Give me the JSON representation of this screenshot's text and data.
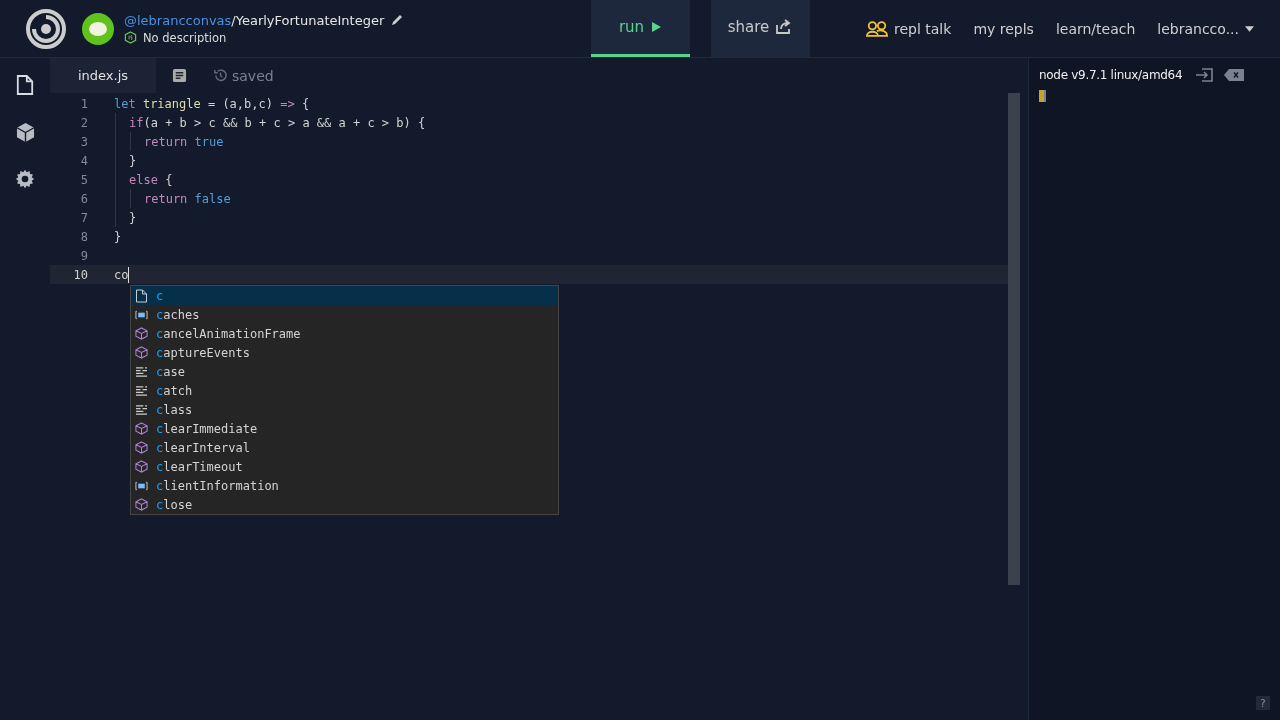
{
  "header": {
    "owner": "@lebrancconvas",
    "repl_name": "/YearlyFortunateInteger",
    "description": "No description",
    "actions": [
      {
        "label": "run",
        "kind": "run",
        "selected": true
      },
      {
        "label": "share",
        "kind": "share",
        "selected": false
      }
    ],
    "nav": [
      {
        "label": "repl talk",
        "kind": "talk"
      },
      {
        "label": "my repls",
        "kind": "plain"
      },
      {
        "label": "learn/teach",
        "kind": "plain"
      },
      {
        "label": "lebrancco...",
        "kind": "user"
      }
    ]
  },
  "sidebar": [
    {
      "kind": "files",
      "selected": true
    },
    {
      "kind": "packages",
      "selected": false
    },
    {
      "kind": "settings",
      "selected": false
    }
  ],
  "editor": {
    "tab": "index.js",
    "status": "saved",
    "lines": [
      {
        "number": "1",
        "current": false,
        "tokens": [
          {
            "text": "let",
            "kind": "keyword"
          },
          {
            "text": " triangle",
            "kind": "function"
          },
          {
            "text": " = (a,b,c) ",
            "kind": "plain"
          },
          {
            "text": "=>",
            "kind": "control"
          },
          {
            "text": " {",
            "kind": "plain"
          }
        ],
        "children": [
          {
            "number": "2",
            "current": false,
            "tokens": [
              {
                "text": "if",
                "kind": "control"
              },
              {
                "text": "(a + b > c && b + c > a && a + c > b) {",
                "kind": "plain"
              }
            ],
            "children": [
              {
                "number": "3",
                "current": false,
                "tokens": [
                  {
                    "text": "return",
                    "kind": "control"
                  },
                  {
                    "text": " true",
                    "kind": "keyword"
                  }
                ]
              }
            ]
          },
          {
            "number": "4",
            "current": false,
            "tokens": [
              {
                "text": "}",
                "kind": "plain"
              }
            ]
          },
          {
            "number": "5",
            "current": false,
            "tokens": [
              {
                "text": "else",
                "kind": "control"
              },
              {
                "text": " {",
                "kind": "plain"
              }
            ],
            "children": [
              {
                "number": "6",
                "current": false,
                "tokens": [
                  {
                    "text": "return",
                    "kind": "control"
                  },
                  {
                    "text": " false",
                    "kind": "keyword"
                  }
                ]
              }
            ]
          },
          {
            "number": "7",
            "current": false,
            "tokens": [
              {
                "text": "}",
                "kind": "plain"
              }
            ]
          }
        ]
      },
      {
        "number": "8",
        "current": false,
        "tokens": [
          {
            "text": "}",
            "kind": "plain"
          }
        ]
      },
      {
        "number": "9",
        "current": false
      },
      {
        "number": "10",
        "current": true,
        "tokens": [
          {
            "text": "co",
            "kind": "plain"
          }
        ]
      }
    ],
    "suggestions": [
      {
        "match": "c",
        "kind": "file",
        "selected": true
      },
      {
        "match": "c",
        "rest": "aches",
        "kind": "variable",
        "selected": false
      },
      {
        "match": "c",
        "rest": "ancelAnimationFrame",
        "kind": "method",
        "selected": false
      },
      {
        "match": "c",
        "rest": "aptureEvents",
        "kind": "method",
        "selected": false
      },
      {
        "match": "c",
        "rest": "ase",
        "kind": "keyword",
        "selected": false
      },
      {
        "match": "c",
        "rest": "atch",
        "kind": "keyword",
        "selected": false
      },
      {
        "match": "c",
        "rest": "lass",
        "kind": "keyword",
        "selected": false
      },
      {
        "match": "c",
        "rest": "learImmediate",
        "kind": "method",
        "selected": false
      },
      {
        "match": "c",
        "rest": "learInterval",
        "kind": "method",
        "selected": false
      },
      {
        "match": "c",
        "rest": "learTimeout",
        "kind": "method",
        "selected": false
      },
      {
        "match": "c",
        "rest": "lientInformation",
        "kind": "variable",
        "selected": false
      },
      {
        "match": "c",
        "rest": "lose",
        "kind": "method",
        "selected": false
      }
    ]
  },
  "console": {
    "version": "node v9.7.1 linux/amd64"
  },
  "help": "?"
}
